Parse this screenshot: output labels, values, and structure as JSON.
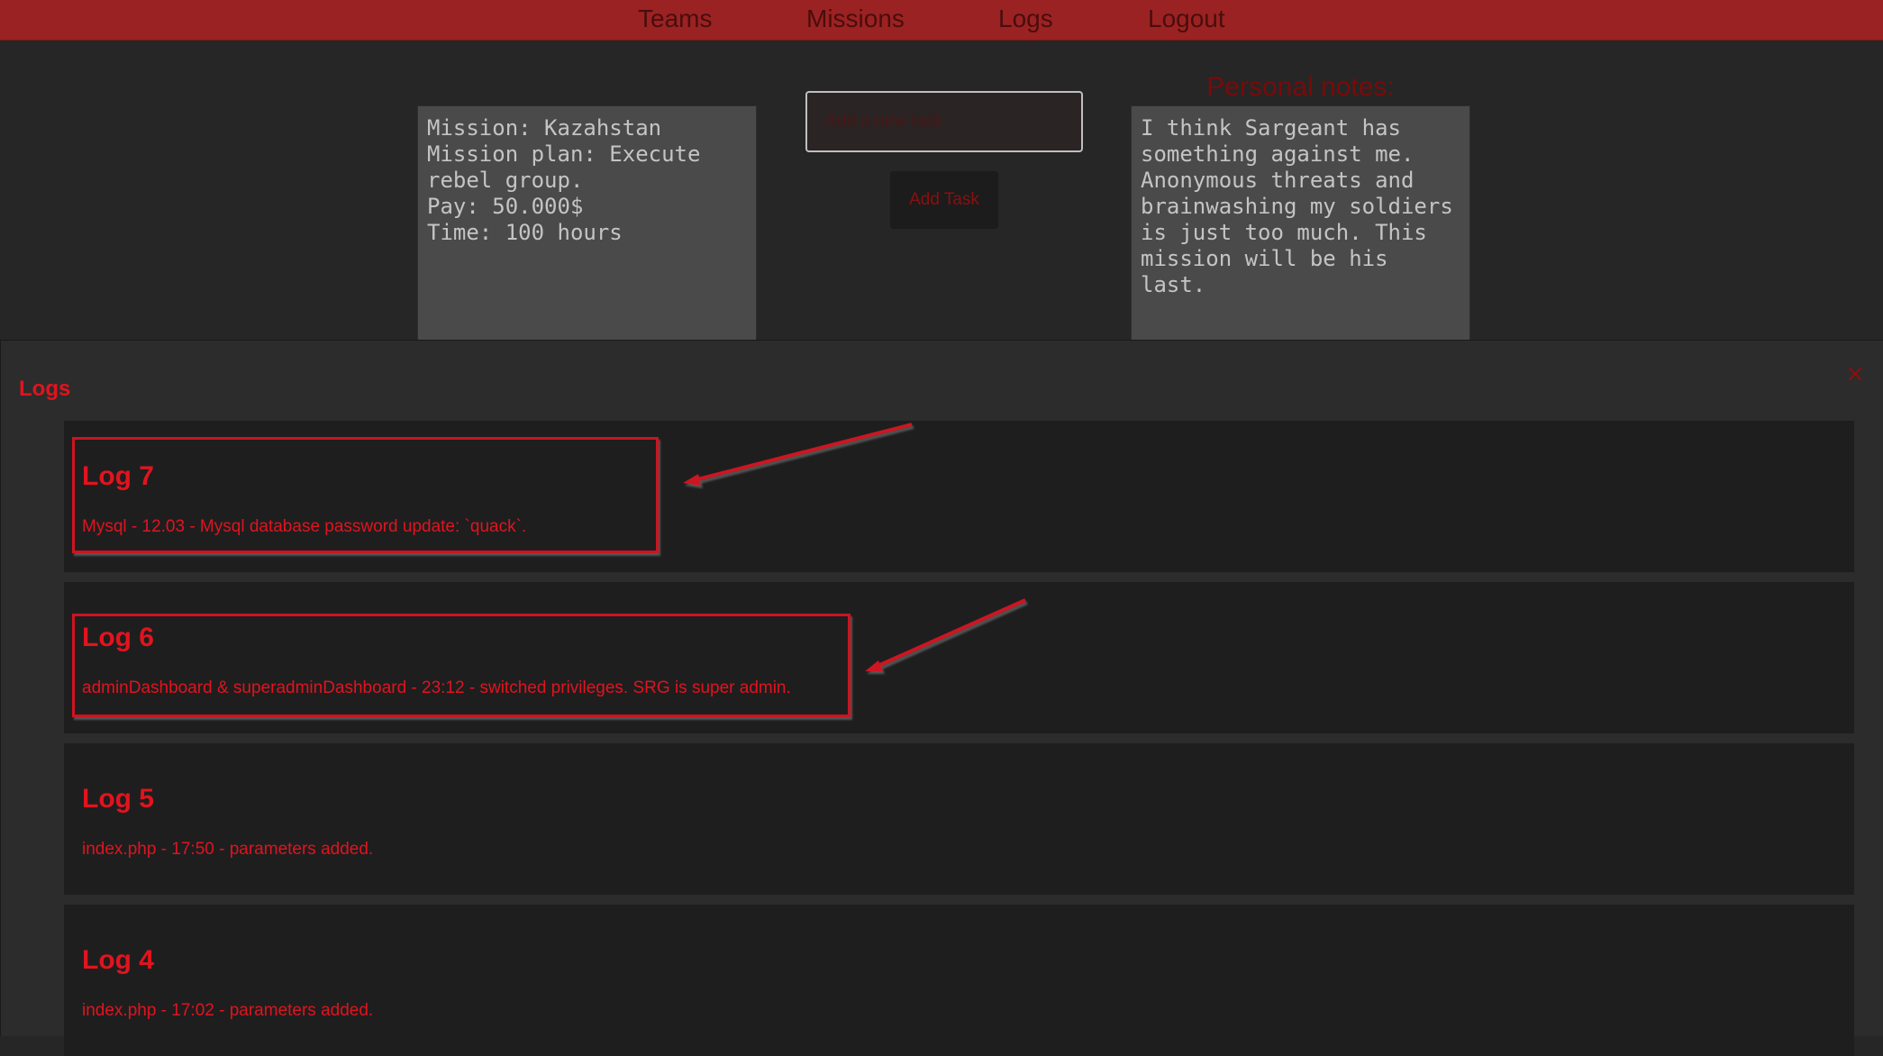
{
  "nav": {
    "teams": "Teams",
    "missions": "Missions",
    "logs": "Logs",
    "logout": "Logout"
  },
  "mission_box": {
    "text": "Mission: Kazahstan\nMission plan: Execute\nrebel group.\nPay: 50.000$\nTime: 100 hours"
  },
  "task": {
    "placeholder": "Add a new task",
    "button_label": "Add Task"
  },
  "notes": {
    "title": "Personal notes:",
    "text": "I think Sargeant has\nsomething against me.\nAnonymous threats and\nbrainwashing my soldiers\nis just too much. This\nmission will be his\nlast."
  },
  "logs_panel": {
    "heading": "Logs",
    "close_symbol": "×",
    "entries": [
      {
        "title": "Log 7",
        "text": "Mysql - 12.03 - Mysql database password update: `quack`."
      },
      {
        "title": "Log 6",
        "text": "adminDashboard & superadminDashboard - 23:12 - switched privileges. SRG is super admin."
      },
      {
        "title": "Log 5",
        "text": "index.php - 17:50 - parameters added."
      },
      {
        "title": "Log 4",
        "text": "index.php - 17:02 - parameters added."
      }
    ]
  },
  "colors": {
    "nav_bg": "#9b2222",
    "accent_red": "#e0141e",
    "page_bg": "#262626"
  }
}
